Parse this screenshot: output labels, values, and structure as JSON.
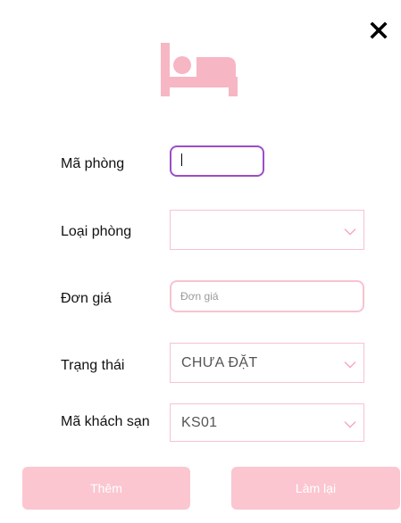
{
  "form": {
    "room_id_label": "Mã phòng",
    "room_id_value": "",
    "room_type_label": "Loại phòng",
    "room_type_value": "",
    "price_label": "Đơn giá",
    "price_placeholder": "Đơn giá",
    "price_value": "",
    "status_label": "Trạng thái",
    "status_value": "CHƯA ĐẶT",
    "hotel_id_label": "Mã khách sạn",
    "hotel_id_value": "KS01"
  },
  "actions": {
    "add_label": "Thêm",
    "reset_label": "Làm lại"
  },
  "icons": {
    "close": "close-icon",
    "header": "bed-icon",
    "dropdown": "chevron-down-icon"
  },
  "colors": {
    "accent_pink": "#f7b6c4",
    "button_pink": "#fbc6d0",
    "focus_purple": "#9b4ec7",
    "border_pink": "#f7c3cf"
  }
}
